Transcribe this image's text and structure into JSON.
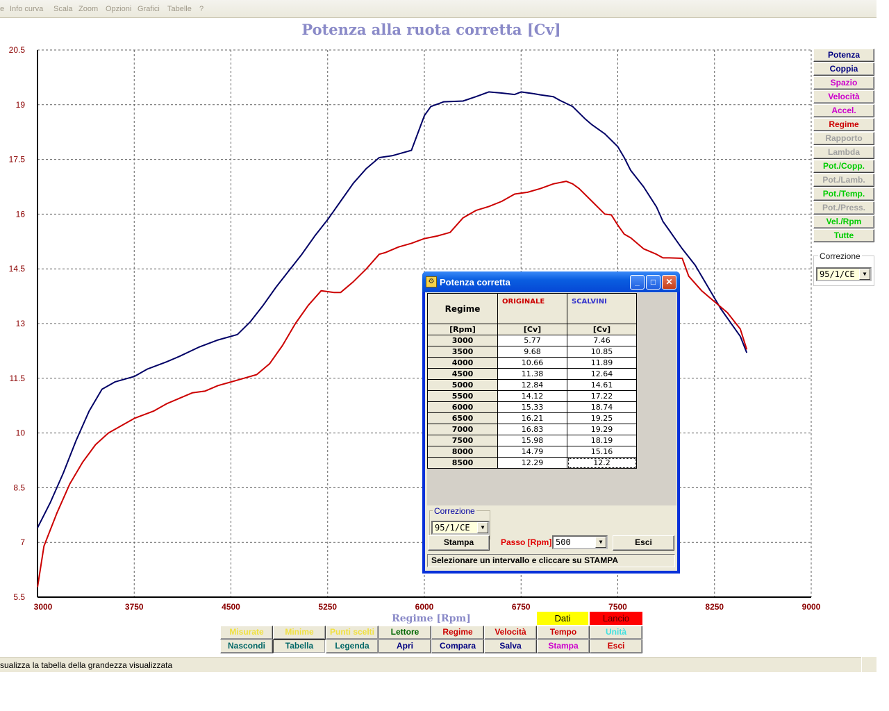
{
  "menubar": {
    "edge_char": "e",
    "items": [
      "Info curva",
      "Scala",
      "Zoom",
      "Opzioni",
      "Grafici",
      "Tabelle",
      "?"
    ]
  },
  "chart_data": {
    "type": "line",
    "title": "Potenza alla ruota corretta [Cv]",
    "xlabel": "Regime [Rpm]",
    "ylabel": "",
    "xlim": [
      3000,
      9000
    ],
    "ylim": [
      5.5,
      20.5
    ],
    "x_ticks": [
      "3000",
      "3750",
      "4500",
      "5250",
      "6000",
      "6750",
      "7500",
      "8250",
      "9000"
    ],
    "y_ticks": [
      "5.5",
      "7",
      "8.5",
      "10",
      "11.5",
      "13",
      "14.5",
      "16",
      "17.5",
      "19",
      "20.5"
    ],
    "grid": true,
    "series": [
      {
        "color": "#000066",
        "x": [
          3000,
          3100,
          3200,
          3300,
          3400,
          3500,
          3600,
          3750,
          3850,
          4000,
          4100,
          4250,
          4400,
          4550,
          4650,
          4750,
          4850,
          4950,
          5050,
          5150,
          5250,
          5350,
          5450,
          5550,
          5650,
          5750,
          5800,
          5900,
          6000,
          6050,
          6150,
          6300,
          6400,
          6500,
          6600,
          6700,
          6750,
          6850,
          6900,
          7000,
          7050,
          7150,
          7250,
          7300,
          7400,
          7500,
          7550,
          7600,
          7700,
          7800,
          7850,
          7900,
          7950,
          8000,
          8100,
          8200,
          8300,
          8400,
          8450,
          8500
        ],
        "y": [
          7.4,
          8.1,
          8.9,
          9.8,
          10.6,
          11.2,
          11.4,
          11.55,
          11.75,
          11.95,
          12.1,
          12.35,
          12.55,
          12.7,
          13.05,
          13.5,
          14.0,
          14.45,
          14.9,
          15.4,
          15.85,
          16.35,
          16.85,
          17.25,
          17.55,
          17.6,
          17.65,
          17.75,
          18.7,
          18.95,
          19.08,
          19.1,
          19.22,
          19.35,
          19.32,
          19.28,
          19.35,
          19.3,
          19.27,
          19.22,
          19.12,
          18.95,
          18.6,
          18.45,
          18.2,
          17.85,
          17.55,
          17.2,
          16.75,
          16.2,
          15.8,
          15.55,
          15.3,
          15.05,
          14.6,
          14.0,
          13.4,
          12.9,
          12.65,
          12.2
        ]
      },
      {
        "color": "#cc0000",
        "x": [
          3000,
          3050,
          3150,
          3250,
          3350,
          3450,
          3550,
          3650,
          3750,
          3900,
          4000,
          4100,
          4200,
          4300,
          4400,
          4500,
          4600,
          4700,
          4800,
          4900,
          5000,
          5100,
          5200,
          5300,
          5350,
          5450,
          5550,
          5650,
          5700,
          5800,
          5900,
          6000,
          6100,
          6200,
          6300,
          6400,
          6500,
          6600,
          6700,
          6800,
          6900,
          7000,
          7100,
          7150,
          7200,
          7300,
          7400,
          7450,
          7500,
          7550,
          7600,
          7700,
          7800,
          7850,
          7900,
          8000,
          8050,
          8150,
          8250,
          8350,
          8450,
          8500
        ],
        "y": [
          5.77,
          6.9,
          7.8,
          8.6,
          9.2,
          9.68,
          10.0,
          10.2,
          10.4,
          10.6,
          10.8,
          10.95,
          11.1,
          11.15,
          11.3,
          11.4,
          11.5,
          11.6,
          11.9,
          12.4,
          13.0,
          13.5,
          13.9,
          13.85,
          13.85,
          14.15,
          14.5,
          14.9,
          14.95,
          15.1,
          15.2,
          15.33,
          15.4,
          15.5,
          15.9,
          16.1,
          16.21,
          16.35,
          16.55,
          16.6,
          16.7,
          16.83,
          16.9,
          16.83,
          16.7,
          16.35,
          16.0,
          15.98,
          15.7,
          15.45,
          15.35,
          15.05,
          14.9,
          14.8,
          14.8,
          14.79,
          14.3,
          13.9,
          13.6,
          13.3,
          12.85,
          12.29
        ]
      }
    ]
  },
  "side_buttons": [
    {
      "label": "Potenza",
      "color": "#000080"
    },
    {
      "label": "Coppia",
      "color": "#000080"
    },
    {
      "label": "Spazio",
      "color": "#cc00cc"
    },
    {
      "label": "Velocità",
      "color": "#cc00cc"
    },
    {
      "label": "Accel.",
      "color": "#cc00cc"
    },
    {
      "label": "Regime",
      "color": "#cc0000"
    },
    {
      "label": "Rapporto",
      "color": "#a0a0a0"
    },
    {
      "label": "Lambda",
      "color": "#a0a0a0"
    },
    {
      "label": "Pot./Copp.",
      "color": "#00cc00"
    },
    {
      "label": "Pot./Lamb.",
      "color": "#a0a0a0"
    },
    {
      "label": "Pot./Temp.",
      "color": "#00cc00"
    },
    {
      "label": "Pot./Press.",
      "color": "#a0a0a0"
    },
    {
      "label": "Vel./Rpm",
      "color": "#00cc00"
    },
    {
      "label": "Tutte",
      "color": "#00cc00"
    }
  ],
  "side_correction": {
    "label": "Correzione",
    "value": "95/1/CE"
  },
  "bottom": {
    "dati_label": "Dati",
    "lancio_label": "Lancio",
    "row1": [
      {
        "label": "Misurate",
        "color": "#f0e040"
      },
      {
        "label": "Minime",
        "color": "#f0e040"
      },
      {
        "label": "Punti scelti",
        "color": "#f0e040"
      },
      {
        "label": "Lettore",
        "color": "#006600"
      },
      {
        "label": "Regime",
        "color": "#cc0000"
      },
      {
        "label": "Velocità",
        "color": "#cc0000"
      },
      {
        "label": "Tempo",
        "color": "#cc0000"
      },
      {
        "label": "Unità",
        "color": "#40e0e0"
      }
    ],
    "row2": [
      {
        "label": "Nascondi",
        "color": "#006666"
      },
      {
        "label": "Tabella",
        "color": "#006666"
      },
      {
        "label": "Legenda",
        "color": "#006666"
      },
      {
        "label": "Apri",
        "color": "#000080"
      },
      {
        "label": "Compara",
        "color": "#000080"
      },
      {
        "label": "Salva",
        "color": "#000080"
      },
      {
        "label": "Stampa",
        "color": "#cc00cc"
      },
      {
        "label": "Esci",
        "color": "#cc0000"
      }
    ]
  },
  "statusbar": {
    "text": "sualizza la tabella della grandezza visualizzata"
  },
  "dialog": {
    "title": "Potenza corretta",
    "icon": "app-icon",
    "table": {
      "col0_header": "Regime",
      "col1_header": "ORIGINALE",
      "col2_header": "SCALVINI",
      "col1_color": "#cc0000",
      "col2_color": "#3333cc",
      "unit_row": [
        "[Rpm]",
        "[Cv]",
        "[Cv]"
      ],
      "rows": [
        [
          "3000",
          "5.77",
          "7.46"
        ],
        [
          "3500",
          "9.68",
          "10.85"
        ],
        [
          "4000",
          "10.66",
          "11.89"
        ],
        [
          "4500",
          "11.38",
          "12.64"
        ],
        [
          "5000",
          "12.84",
          "14.61"
        ],
        [
          "5500",
          "14.12",
          "17.22"
        ],
        [
          "6000",
          "15.33",
          "18.74"
        ],
        [
          "6500",
          "16.21",
          "19.25"
        ],
        [
          "7000",
          "16.83",
          "19.29"
        ],
        [
          "7500",
          "15.98",
          "18.19"
        ],
        [
          "8000",
          "14.79",
          "15.16"
        ],
        [
          "8500",
          "12.29",
          "12.2"
        ]
      ]
    },
    "correction": {
      "label": "Correzione",
      "value": "95/1/CE"
    },
    "stampa_label": "Stampa",
    "passo_label": "Passo [Rpm]",
    "passo_value": "500",
    "esci_label": "Esci",
    "status_text": "Selezionare un intervallo e cliccare su STAMPA"
  }
}
